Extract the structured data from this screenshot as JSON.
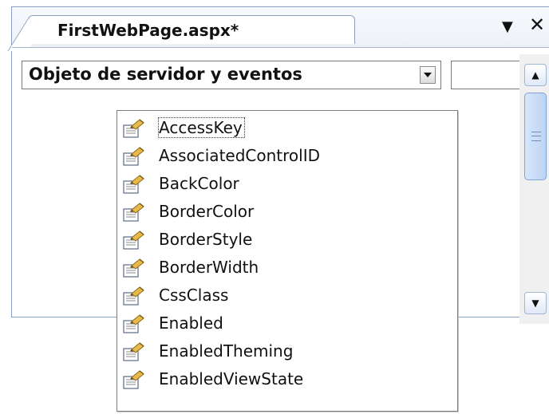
{
  "tab": {
    "title": "FirstWebPage.aspx*",
    "menu_glyph": "▼",
    "close_glyph": "✕"
  },
  "toolbar": {
    "object_combo": "Objeto de servidor y eventos",
    "event_combo": ""
  },
  "scrollbar": {
    "up_glyph": "▲",
    "down_glyph": "▼"
  },
  "completion": {
    "selected": "AccessKey",
    "icon": "property-icon",
    "items": [
      "AccessKey",
      "AssociatedControlID",
      "BackColor",
      "BorderColor",
      "BorderStyle",
      "BorderWidth",
      "CssClass",
      "Enabled",
      "EnabledTheming",
      "EnabledViewState"
    ]
  }
}
